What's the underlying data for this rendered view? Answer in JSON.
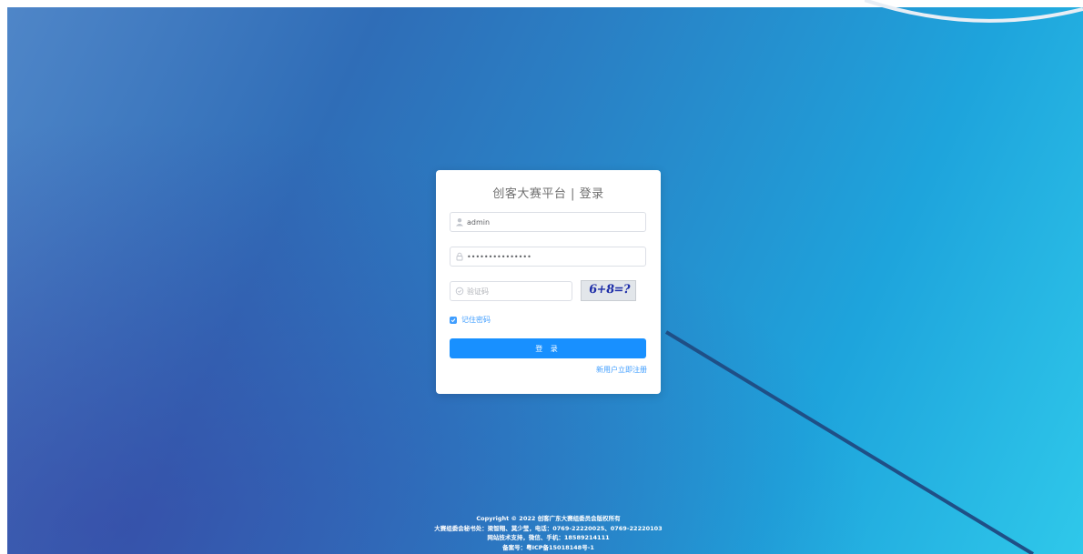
{
  "login": {
    "title": "创客大赛平台 | 登录",
    "username_value": "admin",
    "password_value": "•••••••••••••••",
    "captcha_placeholder": "验证码",
    "captcha_text": "6+8=?",
    "remember_label": "记住密码",
    "remember_checked": true,
    "login_button": "登 录",
    "register_link": "新用户立即注册"
  },
  "footer": {
    "line1": "Copyright © 2022 创客广东大赛组委员会版权所有",
    "line2": "大赛组委会秘书处：梁智翔、莫少莹，电话：0769-22220025、0769-22220103",
    "line3": "网站技术支持，微信、手机：18589214111",
    "line4": "备案号：粤ICP备15018148号-1"
  },
  "colors": {
    "accent": "#1890ff",
    "link": "#409eff"
  },
  "icons": {
    "username": "user-icon",
    "password": "lock-icon",
    "captcha": "shield-check-icon",
    "remember": "checkbox-checked-icon"
  }
}
